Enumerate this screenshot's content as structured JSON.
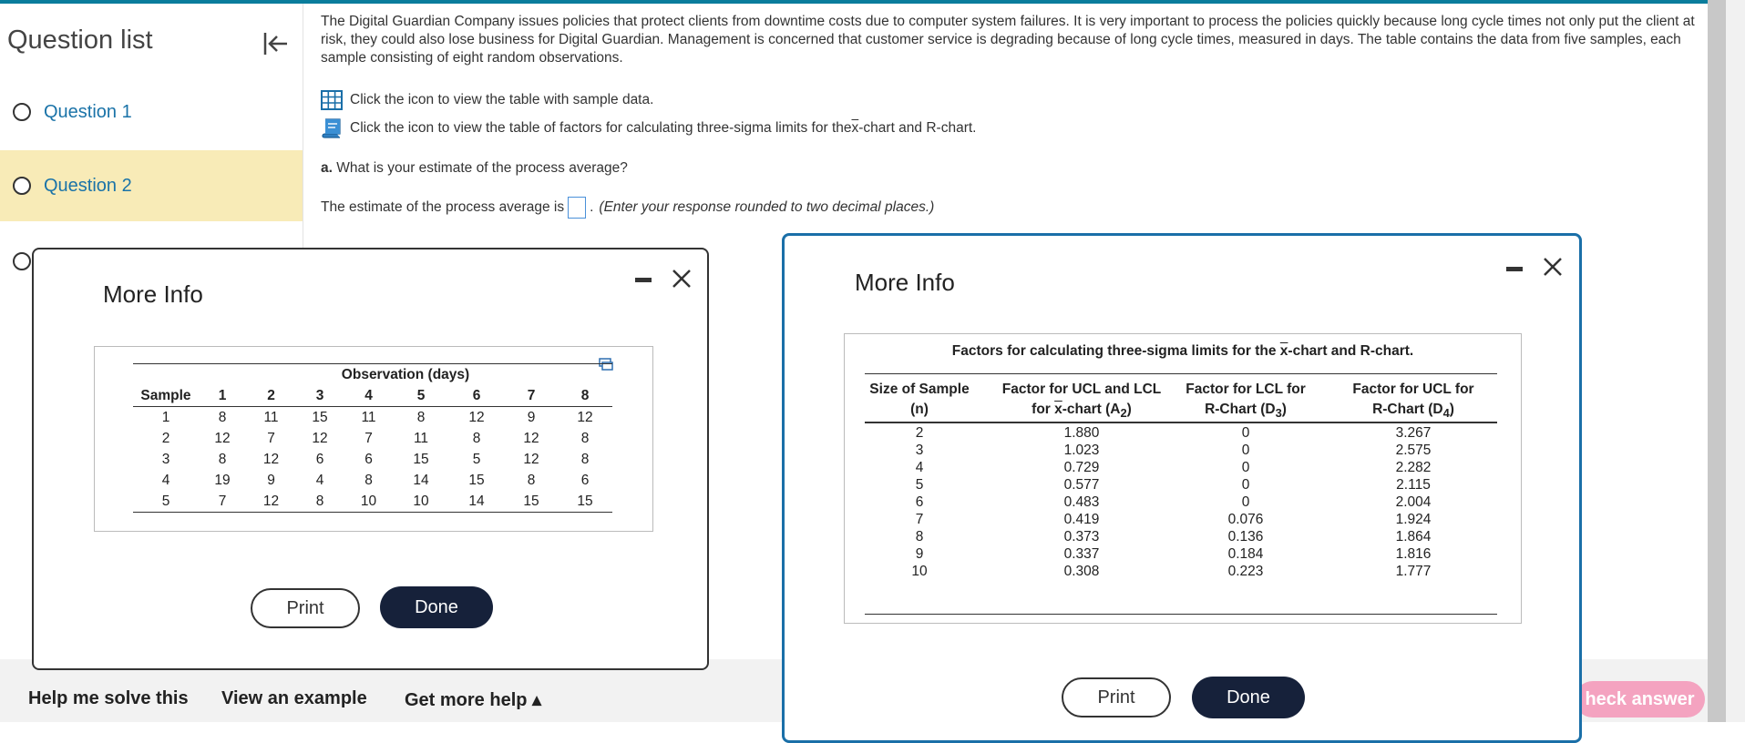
{
  "sidebar": {
    "title": "Question list",
    "items": [
      {
        "label": "Question 1"
      },
      {
        "label": "Question 2"
      }
    ]
  },
  "problem": {
    "text": "The Digital Guardian Company issues policies that protect clients from downtime costs due to computer system failures. It is very important to process the policies quickly because long cycle times not only put the client at risk, they could also lose business for Digital Guardian. Management is concerned that customer service is degrading because of long cycle times, measured in days. The table contains the data from five samples, each sample consisting of eight random observations.",
    "icon_line1": "Click the icon to view the table with sample data.",
    "icon_line2_pre": "Click the icon to view the table of factors for calculating three-sigma limits for the ",
    "icon_line2_x": "x",
    "icon_line2_post": "-chart and R-chart.",
    "part_a_label": "a.",
    "part_a_text": " What is your estimate of the process average?",
    "answer_pre": "The estimate of the process average is",
    "answer_hint": "(Enter your response rounded to two decimal places.)"
  },
  "bottom": {
    "help": "Help me solve this",
    "example": "View an example",
    "more_help": "Get more help ▴",
    "check": "heck answer"
  },
  "dialog1": {
    "title": "More Info",
    "group_header": "Observation (days)",
    "headers": [
      "Sample",
      "1",
      "2",
      "3",
      "4",
      "5",
      "6",
      "7",
      "8"
    ],
    "rows": [
      [
        "1",
        "8",
        "11",
        "15",
        "11",
        "8",
        "12",
        "9",
        "12"
      ],
      [
        "2",
        "12",
        "7",
        "12",
        "7",
        "11",
        "8",
        "12",
        "8"
      ],
      [
        "3",
        "8",
        "12",
        "6",
        "6",
        "15",
        "5",
        "12",
        "8"
      ],
      [
        "4",
        "19",
        "9",
        "4",
        "8",
        "14",
        "15",
        "8",
        "6"
      ],
      [
        "5",
        "7",
        "12",
        "8",
        "10",
        "10",
        "14",
        "15",
        "15"
      ]
    ],
    "print": "Print",
    "done": "Done"
  },
  "dialog2": {
    "title": "More Info",
    "table_title_pre": "Factors for calculating three-sigma limits for the ",
    "table_title_x": "x",
    "table_title_post": "-chart and R-chart.",
    "h1_line1": "Size of Sample",
    "h1_line2": "(n)",
    "h2_line1": "Factor for UCL and LCL",
    "h2_line2_pre": "for ",
    "h2_line2_x": "x",
    "h2_line2_post": "-chart (A",
    "h2_sub": "2",
    "h3_line1": "Factor for LCL for",
    "h3_line2": "R-Chart (D",
    "h3_sub": "3",
    "h4_line1": "Factor for UCL for",
    "h4_line2": "R-Chart (D",
    "h4_sub": "4",
    "close_paren": ")",
    "rows": [
      [
        "2",
        "1.880",
        "0",
        "3.267"
      ],
      [
        "3",
        "1.023",
        "0",
        "2.575"
      ],
      [
        "4",
        "0.729",
        "0",
        "2.282"
      ],
      [
        "5",
        "0.577",
        "0",
        "2.115"
      ],
      [
        "6",
        "0.483",
        "0",
        "2.004"
      ],
      [
        "7",
        "0.419",
        "0.076",
        "1.924"
      ],
      [
        "8",
        "0.373",
        "0.136",
        "1.864"
      ],
      [
        "9",
        "0.337",
        "0.184",
        "1.816"
      ],
      [
        "10",
        "0.308",
        "0.223",
        "1.777"
      ]
    ],
    "print": "Print",
    "done": "Done"
  },
  "colors": {
    "accent": "#0a7d9c",
    "selected_bg": "#f8ebb7",
    "link": "#1a73a8",
    "done_bg": "#16213a",
    "check_bg": "#f4a3c0"
  }
}
